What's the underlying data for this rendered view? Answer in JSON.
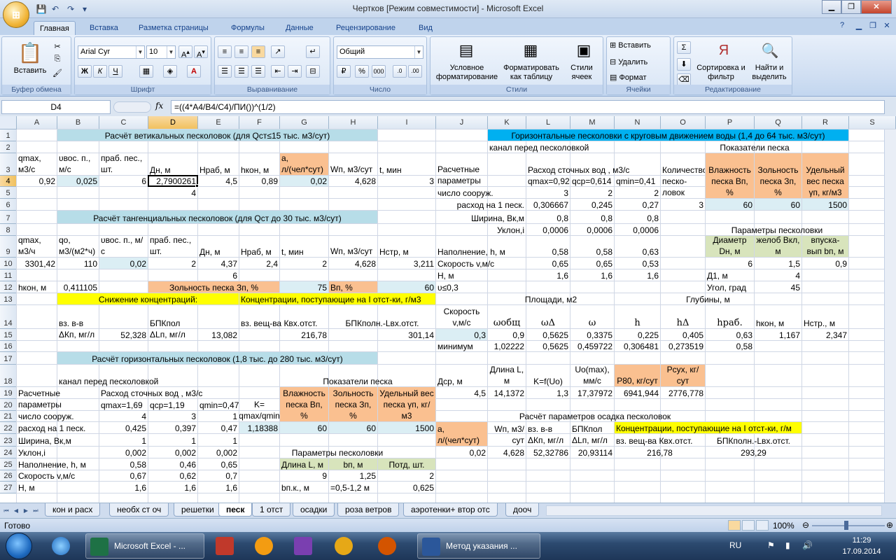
{
  "window": {
    "title": "Чертков  [Режим совместимости] - Microsoft Excel",
    "minimize": "▁",
    "restore": "❐",
    "close": "✕"
  },
  "ribbon_tabs": [
    "Главная",
    "Вставка",
    "Разметка страницы",
    "Формулы",
    "Данные",
    "Рецензирование",
    "Вид"
  ],
  "ribbon": {
    "clipboard": {
      "title": "Буфер обмена",
      "paste": "Вставить"
    },
    "font": {
      "title": "Шрифт",
      "font_name": "Arial Cyr",
      "font_size": "10"
    },
    "alignment": {
      "title": "Выравнивание"
    },
    "number": {
      "title": "Число",
      "format": "Общий"
    },
    "styles": {
      "title": "Стили",
      "conditional": "Условное форматирование",
      "as_table": "Форматировать как таблицу",
      "cell_styles": "Стили ячеек"
    },
    "cells": {
      "title": "Ячейки",
      "insert": "Вставить",
      "delete": "Удалить",
      "format": "Формат"
    },
    "editing": {
      "title": "Редактирование",
      "sort": "Сортировка и фильтр",
      "find": "Найти и выделить"
    }
  },
  "formula_bar": {
    "name_box": "D4",
    "fx": "fx",
    "formula": "=((4*A4/B4/C4)/ПИ())^(1/2)"
  },
  "columns": [
    "A",
    "B",
    "C",
    "D",
    "E",
    "F",
    "G",
    "H",
    "I",
    "J",
    "K",
    "L",
    "M",
    "N",
    "O",
    "P",
    "Q",
    "R",
    "S"
  ],
  "rows": [
    "1",
    "2",
    "3",
    "4",
    "5",
    "6",
    "7",
    "8",
    "9",
    "10",
    "11",
    "12",
    "13",
    "14",
    "15",
    "16",
    "17",
    "18",
    "19",
    "20",
    "21",
    "22",
    "23",
    "24",
    "25",
    "26",
    "27"
  ],
  "cells": [
    {
      "t": "Расчёт ветикальных песколовок (для Qст≤15 тыс. м3/сут)"
    },
    {
      "t": "Горизонтальные песколовки с круговым движением воды (1,4 до 64 тыс. м3/сут)"
    },
    {
      "t": "канал перед песколовкой"
    },
    {
      "t": "Показатели песка"
    },
    {
      "t": "qmax, м3/с"
    },
    {
      "t": "υвос. п., м/с"
    },
    {
      "t": "праб. пес., шт."
    },
    {
      "t": "Дн, м"
    },
    {
      "t": "Нраб, м"
    },
    {
      "t": "hкон, м"
    },
    {
      "t": "a, л/(чел*сут)"
    },
    {
      "t": "Wп, м3/сут"
    },
    {
      "t": "t, мин"
    },
    {
      "t": "Расчетные параметры"
    },
    {
      "t": "Расход сточных вод   , м3/с"
    },
    {
      "t": "Количество песко-ловок"
    },
    {
      "t": "Влажность песка Вп, %"
    },
    {
      "t": "Зольность песка Зп, %"
    },
    {
      "t": "Удельный вес песка γп, кг/м3"
    },
    {
      "t": "0,92"
    },
    {
      "t": "0,025"
    },
    {
      "t": "6"
    },
    {
      "t": "2,7900261"
    },
    {
      "t": "4,5"
    },
    {
      "t": "0,89"
    },
    {
      "t": "0,02"
    },
    {
      "t": "4,628"
    },
    {
      "t": "3"
    },
    {
      "t": "qmax=0,92"
    },
    {
      "t": "qcp=0,614"
    },
    {
      "t": "qmin=0,41"
    },
    {
      "t": "4"
    },
    {
      "t": "число сооруж."
    },
    {
      "t": "3"
    },
    {
      "t": "2"
    },
    {
      "t": "2"
    },
    {
      "t": "расход на 1 песк."
    },
    {
      "t": "0,306667"
    },
    {
      "t": "0,245"
    },
    {
      "t": "0,27"
    },
    {
      "t": "3"
    },
    {
      "t": "60"
    },
    {
      "t": "60"
    },
    {
      "t": "1500"
    },
    {
      "t": "Расчёт тангенциальных песколовок (для Qст до 30 тыс. м3/сут)"
    },
    {
      "t": "Ширина, Вк,м"
    },
    {
      "t": "0,8"
    },
    {
      "t": "0,8"
    },
    {
      "t": "0,8"
    },
    {
      "t": "Уклон,i"
    },
    {
      "t": "0,0006"
    },
    {
      "t": "0,0006"
    },
    {
      "t": "0,0006"
    },
    {
      "t": "Параметры песколовки"
    },
    {
      "t": "qmax, м3/ч"
    },
    {
      "t": "qo, м3/(м2*ч)"
    },
    {
      "t": "υвос. п., м/с"
    },
    {
      "t": "праб. пес., шт."
    },
    {
      "t": "Дн, м"
    },
    {
      "t": "Нраб, м"
    },
    {
      "t": "t, мин"
    },
    {
      "t": "Wп, м3/сут"
    },
    {
      "t": "Нстр, м"
    },
    {
      "t": "Наполнение, h, м"
    },
    {
      "t": "0,58"
    },
    {
      "t": "0,58"
    },
    {
      "t": "0,63"
    },
    {
      "t": "Диаметр Dн, м"
    },
    {
      "t": "желоб Вкл, м"
    },
    {
      "t": "впуска-вып bп, м"
    },
    {
      "t": "3301,42"
    },
    {
      "t": "110"
    },
    {
      "t": "0,02"
    },
    {
      "t": "2"
    },
    {
      "t": "4,37"
    },
    {
      "t": "2,4"
    },
    {
      "t": "2"
    },
    {
      "t": "4,628"
    },
    {
      "t": "3,211"
    },
    {
      "t": "Скорость v,м/с"
    },
    {
      "t": "0,65"
    },
    {
      "t": "0,65"
    },
    {
      "t": "0,53"
    },
    {
      "t": "6"
    },
    {
      "t": "1,5"
    },
    {
      "t": "0,9"
    },
    {
      "t": "6"
    },
    {
      "t": "Н, м"
    },
    {
      "t": "1,6"
    },
    {
      "t": "1,6"
    },
    {
      "t": "1,6"
    },
    {
      "t": "Д1, м"
    },
    {
      "t": "4"
    },
    {
      "t": "hкон, м"
    },
    {
      "t": "0,411105"
    },
    {
      "t": "Зольность песка Зп, %"
    },
    {
      "t": "75"
    },
    {
      "t": "Вп, %"
    },
    {
      "t": "60"
    },
    {
      "t": "υ≤0,3"
    },
    {
      "t": "Угол, град"
    },
    {
      "t": "45"
    },
    {
      "t": "Снижение концентраций:"
    },
    {
      "t": "Концентрации, поступающие на I отст-ки, г/м3"
    },
    {
      "t": "Скорость v,м/с"
    },
    {
      "t": "Площади, м2"
    },
    {
      "t": "Глубины, м"
    },
    {
      "t": "вз. в-в ΔКп, мг/л"
    },
    {
      "t": "52,328"
    },
    {
      "t": "БПКпол ΔLп, мг/л"
    },
    {
      "t": "13,082"
    },
    {
      "t": "вз. вещ-ва Квх.отст."
    },
    {
      "t": "БПКполн.-Lвх.отст."
    },
    {
      "t": "ωобщ"
    },
    {
      "t": "ωΔ"
    },
    {
      "t": "ω"
    },
    {
      "t": "h"
    },
    {
      "t": "hΔ"
    },
    {
      "t": "hраб."
    },
    {
      "t": "hкон, м"
    },
    {
      "t": "Нстр., м"
    },
    {
      "t": "216,78"
    },
    {
      "t": "301,14"
    },
    {
      "t": "0,3"
    },
    {
      "t": "0,9"
    },
    {
      "t": "0,5625"
    },
    {
      "t": "0,3375"
    },
    {
      "t": "0,225"
    },
    {
      "t": "0,405"
    },
    {
      "t": "0,63"
    },
    {
      "t": "1,167"
    },
    {
      "t": "2,347"
    },
    {
      "t": "минимум"
    },
    {
      "t": "1,02222"
    },
    {
      "t": "0,5625"
    },
    {
      "t": "0,459722"
    },
    {
      "t": "0,306481"
    },
    {
      "t": "0,273519"
    },
    {
      "t": "0,58"
    },
    {
      "t": "Расчёт горизонтальных песколовок (1,8 тыс. до 280 тыс. м3/сут)"
    },
    {
      "t": "Дср, м"
    },
    {
      "t": "Длина L, м"
    },
    {
      "t": "K=f(Uo)"
    },
    {
      "t": "Uo(max), мм/с"
    },
    {
      "t": "Р80, кг/сут"
    },
    {
      "t": "Рсух, кг/сут"
    },
    {
      "t": "канал перед песколовкой"
    },
    {
      "t": "Показатели песка"
    },
    {
      "t": "4,5"
    },
    {
      "t": "14,1372"
    },
    {
      "t": "1,3"
    },
    {
      "t": "17,37972"
    },
    {
      "t": "6941,944"
    },
    {
      "t": "2776,778"
    },
    {
      "t": "Расчетные параметры"
    },
    {
      "t": "Расход сточных вод   , м3/с"
    },
    {
      "t": "qmax=1,69"
    },
    {
      "t": "qcp=1,19"
    },
    {
      "t": "qmin=0,47"
    },
    {
      "t": "K= qmax/qmin"
    },
    {
      "t": "Влажность песка Вп, %"
    },
    {
      "t": "Зольность песка Зп, %"
    },
    {
      "t": "Удельный вес песка γп, кг/м3"
    },
    {
      "t": "число сооруж."
    },
    {
      "t": "4"
    },
    {
      "t": "3"
    },
    {
      "t": "1"
    },
    {
      "t": "Расчёт параметров осадка песколовок"
    },
    {
      "t": "расход на 1 песк."
    },
    {
      "t": "0,425"
    },
    {
      "t": "0,397"
    },
    {
      "t": "0,47"
    },
    {
      "t": "1,18388"
    },
    {
      "t": "60"
    },
    {
      "t": "60"
    },
    {
      "t": "1500"
    },
    {
      "t": "a, л/(чел*сут)"
    },
    {
      "t": "Wп, м3/сут"
    },
    {
      "t": "вз. в-в ΔКп, мг/л"
    },
    {
      "t": "БПКпол ΔLп, мг/л"
    },
    {
      "t": "Концентрации, поступающие на I отст-ки, г/м"
    },
    {
      "t": "Ширина, Вк,м"
    },
    {
      "t": "1"
    },
    {
      "t": "1"
    },
    {
      "t": "1"
    },
    {
      "t": "вз. вещ-ва Квх.отст."
    },
    {
      "t": "БПКполн.-Lвх.отст."
    },
    {
      "t": "Уклон,i"
    },
    {
      "t": "0,002"
    },
    {
      "t": "0,002"
    },
    {
      "t": "0,002"
    },
    {
      "t": "Параметры песколовки"
    },
    {
      "t": "0,02"
    },
    {
      "t": "4,628"
    },
    {
      "t": "52,32786"
    },
    {
      "t": "20,93114"
    },
    {
      "t": "216,78"
    },
    {
      "t": "293,29"
    },
    {
      "t": "Наполнение, h, м"
    },
    {
      "t": "0,58"
    },
    {
      "t": "0,46"
    },
    {
      "t": "0,65"
    },
    {
      "t": "Длина L, м"
    },
    {
      "t": "bп, м"
    },
    {
      "t": "Потд, шт."
    },
    {
      "t": "Скорость v,м/с"
    },
    {
      "t": "0,67"
    },
    {
      "t": "0,62"
    },
    {
      "t": "0,7"
    },
    {
      "t": "9"
    },
    {
      "t": "1,25"
    },
    {
      "t": "2"
    },
    {
      "t": "Н, м"
    },
    {
      "t": "1,6"
    },
    {
      "t": "1,6"
    },
    {
      "t": "1,6"
    },
    {
      "t": "bп.к., м"
    },
    {
      "t": "=0,5-1,2 м"
    },
    {
      "t": "0,625"
    }
  ],
  "sheet_tabs": [
    "кон и расх",
    "необх ст оч",
    "решетки",
    "песк",
    "1 отст",
    "осадки",
    "роза ветров",
    "аэротенки+ втор отс",
    "дооч"
  ],
  "active_sheet": "песк",
  "status": {
    "ready": "Готово",
    "zoom": "100%"
  },
  "taskbar": {
    "apps": [
      "Microsoft Excel - ...",
      "Метод указания ..."
    ],
    "lang": "RU",
    "time": "11:29",
    "date": "17.09.2014"
  }
}
